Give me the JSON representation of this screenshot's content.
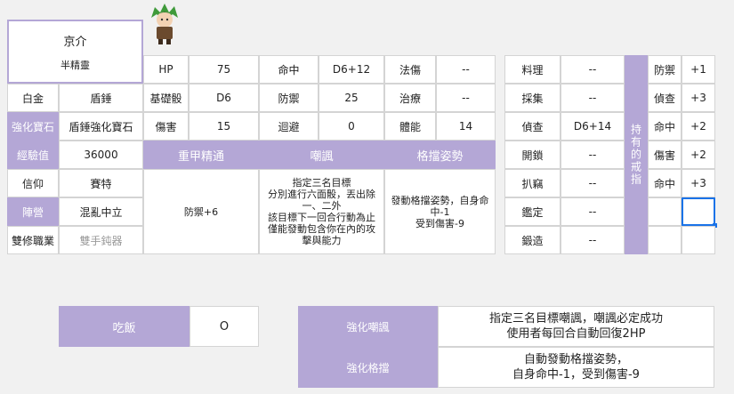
{
  "character": {
    "name": "京介",
    "race": "半精靈"
  },
  "info_rows": [
    {
      "label": "白金",
      "value": "盾錘",
      "label_style": "lbl"
    },
    {
      "label": "強化寶石",
      "value": "盾錘強化寶石",
      "label_style": "purple"
    },
    {
      "label": "經驗值",
      "value": "36000",
      "label_style": "purple"
    },
    {
      "label": "信仰",
      "value": "賽特",
      "label_style": "lbl"
    },
    {
      "label": "陣營",
      "value": "混亂中立",
      "label_style": "purple"
    },
    {
      "label": "雙修職業",
      "value": "雙手鈍器",
      "label_style": "lbl",
      "value_grey": true
    }
  ],
  "stats": [
    {
      "l1": "HP",
      "v1": "75",
      "l2": "命中",
      "v2": "D6+12",
      "l3": "法傷",
      "v3": "--"
    },
    {
      "l1": "基礎骰",
      "v1": "D6",
      "l2": "防禦",
      "v2": "25",
      "l3": "治療",
      "v3": "--"
    },
    {
      "l1": "傷害",
      "v1": "15",
      "l2": "迴避",
      "v2": "0",
      "l3": "體能",
      "v3": "14"
    }
  ],
  "abilities": {
    "headers": [
      "重甲精通",
      "嘲諷",
      "格擋姿勢"
    ],
    "texts": [
      "防禦+6",
      "指定三名目標\n分別進行六面骰，丟出除一、二外\n該目標下一回合行動為止\n僅能發動包含你在內的攻擊與能力",
      "發動格擋姿勢，自身命中-1\n受到傷害-9"
    ]
  },
  "skills": [
    {
      "label": "料理",
      "value": "--"
    },
    {
      "label": "採集",
      "value": "--"
    },
    {
      "label": "偵查",
      "value": "D6+14"
    },
    {
      "label": "開鎖",
      "value": "--"
    },
    {
      "label": "扒竊",
      "value": "--"
    },
    {
      "label": "鑑定",
      "value": "--"
    },
    {
      "label": "鍛造",
      "value": "--"
    }
  ],
  "rings": {
    "title": "持有的戒指",
    "items": [
      {
        "label": "防禦",
        "value": "+1"
      },
      {
        "label": "偵查",
        "value": "+3"
      },
      {
        "label": "命中",
        "value": "+2"
      },
      {
        "label": "傷害",
        "value": "+2"
      },
      {
        "label": "命中",
        "value": "+3"
      },
      {
        "label": "",
        "value": ""
      },
      {
        "label": "",
        "value": ""
      }
    ]
  },
  "meal": {
    "label": "吃飯",
    "value": "O"
  },
  "enhancements": [
    {
      "label": "強化嘲諷",
      "text": "指定三名目標嘲諷，嘲諷必定成功\n使用者每回合自動回復2HP"
    },
    {
      "label": "強化格擋",
      "text": "自動發動格擋姿勢，\n自身命中-1，受到傷害-9"
    }
  ],
  "colors": {
    "accent": "#b4a7d6",
    "selection": "#1a73e8",
    "background": "#f1f1f1"
  }
}
